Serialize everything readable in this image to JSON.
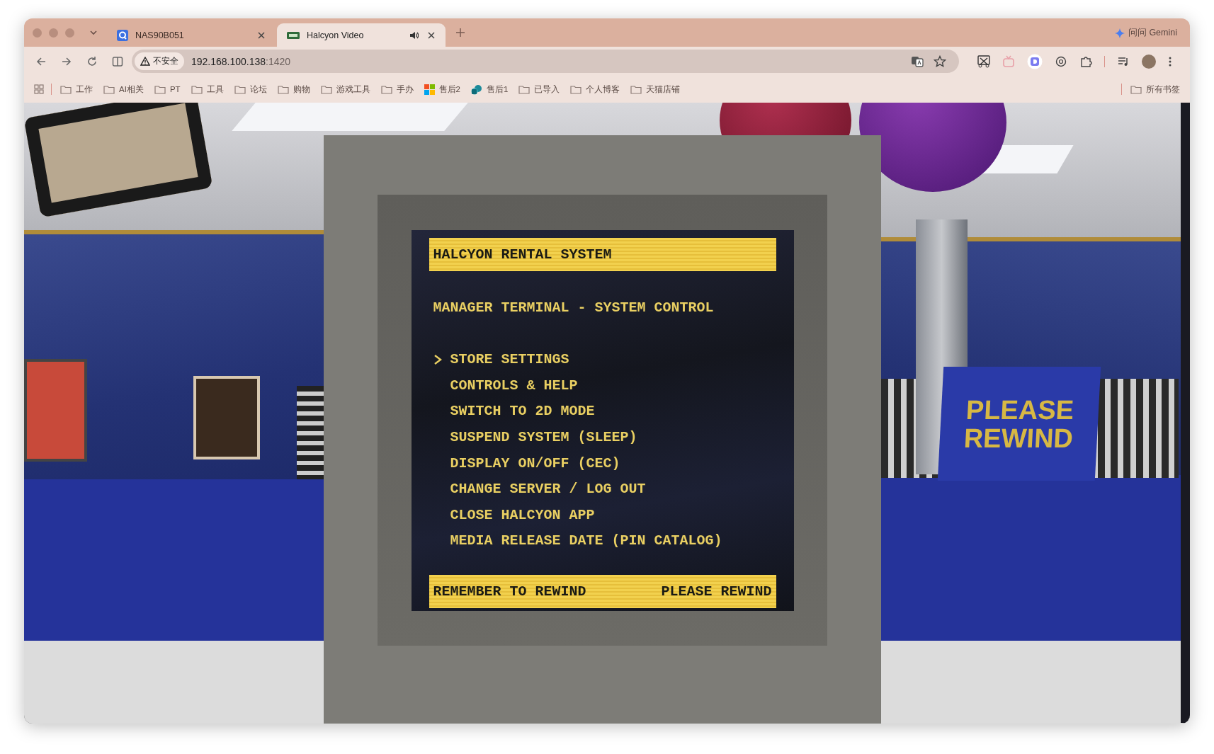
{
  "browser": {
    "tabs": [
      {
        "title": "NAS90B051",
        "selected": false,
        "audio": false
      },
      {
        "title": "Halcyon Video",
        "selected": true,
        "audio": true
      }
    ],
    "gemini_label": "问问 Gemini",
    "address": {
      "security_label": "不安全",
      "host": "192.168.100.138",
      "port": ":1420"
    },
    "bookmarks": [
      {
        "label": "工作",
        "kind": "folder"
      },
      {
        "label": "AI相关",
        "kind": "folder"
      },
      {
        "label": "PT",
        "kind": "folder"
      },
      {
        "label": "工具",
        "kind": "folder"
      },
      {
        "label": "论坛",
        "kind": "folder"
      },
      {
        "label": "购物",
        "kind": "folder"
      },
      {
        "label": "游戏工具",
        "kind": "folder"
      },
      {
        "label": "手办",
        "kind": "folder"
      },
      {
        "label": "售后2",
        "kind": "tiles"
      },
      {
        "label": "售后1",
        "kind": "cloud"
      },
      {
        "label": "已导入",
        "kind": "folder"
      },
      {
        "label": "个人博客",
        "kind": "folder"
      },
      {
        "label": "天猫店铺",
        "kind": "folder"
      }
    ],
    "all_bookmarks": "所有书签"
  },
  "terminal": {
    "title": "HALCYON RENTAL SYSTEM",
    "subtitle": "MANAGER TERMINAL - SYSTEM CONTROL",
    "menu": [
      {
        "label": "STORE SETTINGS",
        "selected": true
      },
      {
        "label": "CONTROLS & HELP",
        "selected": false
      },
      {
        "label": "SWITCH TO 2D MODE",
        "selected": false
      },
      {
        "label": "SUSPEND SYSTEM (SLEEP)",
        "selected": false
      },
      {
        "label": "DISPLAY ON/OFF (CEC)",
        "selected": false
      },
      {
        "label": "CHANGE SERVER / LOG OUT",
        "selected": false
      },
      {
        "label": "CLOSE HALCYON APP",
        "selected": false
      },
      {
        "label": "MEDIA RELEASE DATE (PIN CATALOG)",
        "selected": false
      }
    ],
    "footer_left": "REMEMBER TO REWIND",
    "footer_right": "PLEASE REWIND"
  },
  "store_sign": {
    "line_1": "PLEASE",
    "line_2": "REWIND"
  }
}
